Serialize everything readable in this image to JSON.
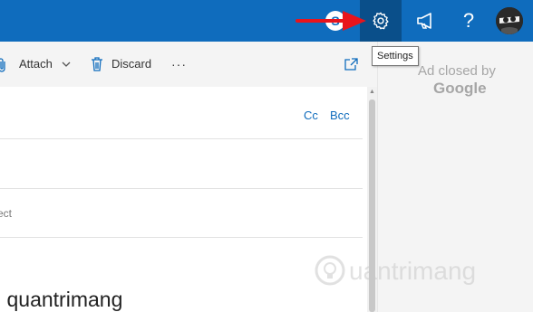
{
  "topbar": {
    "tooltip": "Settings",
    "help_glyph": "?",
    "accent": "#0f6cbd",
    "icons": [
      "skype-icon",
      "gear-icon",
      "megaphone-icon",
      "help-icon",
      "avatar"
    ]
  },
  "toolbar": {
    "attach_label": "Attach",
    "discard_label": "Discard",
    "more_label": "···"
  },
  "compose": {
    "cc_label": "Cc",
    "bcc_label": "Bcc",
    "subject_placeholder": "ect",
    "body_text": "l quantrimang"
  },
  "ad": {
    "line1": "Ad closed by",
    "line2": "Google"
  },
  "watermark": {
    "text": "uantrimang"
  }
}
